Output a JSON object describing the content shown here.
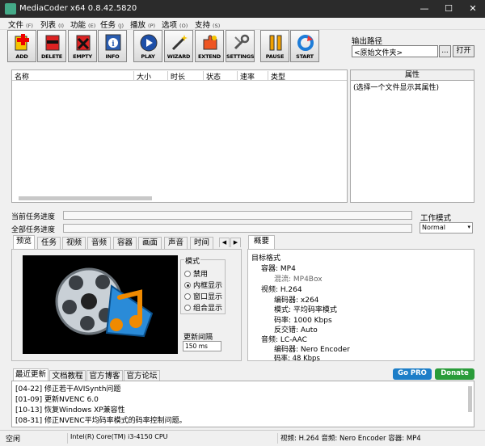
{
  "window": {
    "title": "MediaCoder x64 0.8.42.5820"
  },
  "menu": [
    {
      "label": "文件",
      "shortcut": "(F)"
    },
    {
      "label": "列表",
      "shortcut": "(I)"
    },
    {
      "label": "功能",
      "shortcut": "(E)"
    },
    {
      "label": "任务",
      "shortcut": "(J)"
    },
    {
      "label": "播放",
      "shortcut": "(P)"
    },
    {
      "label": "选项",
      "shortcut": "(O)"
    },
    {
      "label": "支持",
      "shortcut": "(S)"
    }
  ],
  "toolbar": {
    "add": "ADD",
    "delete": "DELETE",
    "empty": "EMPTY",
    "info": "INFO",
    "play": "PLAY",
    "wizard": "WIZARD",
    "extend": "EXTEND",
    "settings": "SETTINGS",
    "pause": "PAUSE",
    "start": "START"
  },
  "output": {
    "label": "输出路径",
    "value": "<原始文件夹>",
    "browse": "...",
    "open": "打开"
  },
  "filelist": {
    "columns": [
      "名称",
      "大小",
      "时长",
      "状态",
      "速率",
      "类型"
    ]
  },
  "properties": {
    "header": "属性",
    "hint": "(选择一个文件显示其属性)"
  },
  "progress": {
    "current": "当前任务进度",
    "all": "全部任务进度"
  },
  "workmode": {
    "label": "工作模式",
    "value": "Normal"
  },
  "left_tabs": [
    "预览",
    "任务",
    "视频",
    "音频",
    "容器",
    "画面",
    "声音",
    "时间"
  ],
  "preview": {
    "mode_label": "模式",
    "modes": [
      "禁用",
      "内框显示",
      "窗口显示",
      "组合显示"
    ],
    "selected_mode": "内框显示",
    "refresh_label": "更新间隔",
    "refresh_value": "150 ms"
  },
  "summary": {
    "tab": "概要",
    "lines": [
      "目标格式",
      "容器: MP4",
      "混流: MP4Box",
      "视频: H.264",
      "编码器: x264",
      "模式: 平均码率模式",
      "码率: 1000 Kbps",
      "反交错: Auto",
      "音频: LC-AAC",
      "编码器: Nero Encoder",
      "码率: 48 Kbps"
    ]
  },
  "news": {
    "tabs": [
      "最近更新",
      "文档教程",
      "官方博客",
      "官方论坛"
    ],
    "items": [
      "[04-22] 修正若干AVISynth问题",
      "[01-09] 更新NVENC 6.0",
      "[10-13] 恢复Windows XP兼容性",
      "[08-31] 修正NVENC平均码率模式的码率控制问题。"
    ],
    "gopro": "Go PRO",
    "donate": "Donate"
  },
  "status": {
    "state": "空闲",
    "cpu": "Intel(R) Core(TM) i3-4150 CPU",
    "format": "视频: H.264 音频: Nero Encoder 容器: MP4"
  }
}
